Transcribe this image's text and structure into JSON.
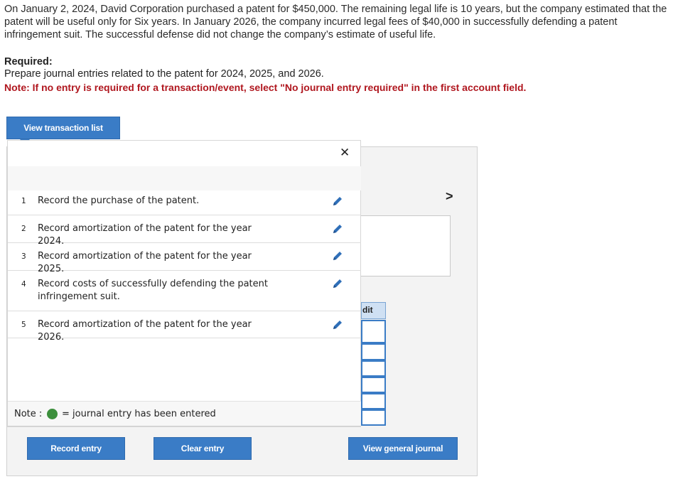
{
  "intro": {
    "paragraph": "On January 2, 2024, David Corporation purchased a patent for $450,000. The remaining legal life is 10 years, but the company estimated that the patent will be useful only for Six years. In January 2026, the company incurred legal fees of $40,000 in successfully defending a patent infringement suit. The successful defense did not change the company’s estimate of useful life."
  },
  "required": {
    "title": "Required:",
    "text": "Prepare journal entries related to the patent for 2024, 2025, and 2026.",
    "note": "Note: If no entry is required for a transaction/event, select \"No journal entry required\" in the first account field."
  },
  "buttons": {
    "view_transaction_list": "View transaction list",
    "record_entry": "Record entry",
    "clear_entry": "Clear entry",
    "view_general_journal": "View general journal"
  },
  "popup": {
    "close_symbol": "✕",
    "transactions": [
      {
        "num": "1",
        "text": "Record the purchase of the patent."
      },
      {
        "num": "2",
        "text": "Record amortization of the patent for the year 2024."
      },
      {
        "num": "3",
        "text": "Record amortization of the patent for the year 2025."
      },
      {
        "num": "4",
        "text": "Record costs of successfully defending the patent infringement suit."
      },
      {
        "num": "5",
        "text": "Record amortization of the patent for the year 2026."
      }
    ],
    "note_label": "Note :",
    "note_text": "= journal entry has been entered"
  },
  "worksheet": {
    "next_symbol": ">",
    "credit_header_fragment": "dit"
  },
  "colors": {
    "button_blue": "#3a7cc6",
    "note_red": "#b0171f",
    "entered_green": "#3c8f3c"
  },
  "icons": {
    "edit": "pencil-icon",
    "close": "close-icon",
    "next": "chevron-right-icon"
  }
}
